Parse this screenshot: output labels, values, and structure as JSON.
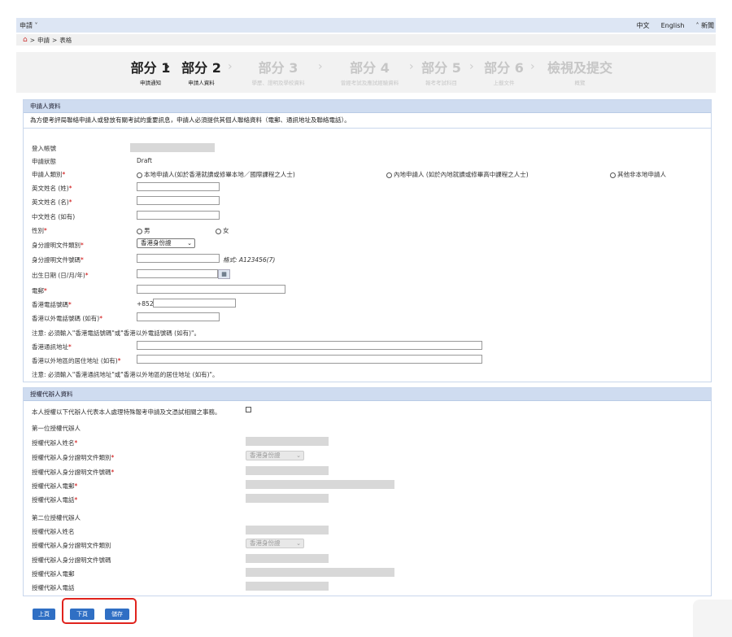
{
  "topbar": {
    "menu": "申請 ˅",
    "lang_zh": "中文",
    "lang_en": "English",
    "help": "˄ 新聞"
  },
  "breadcrumb": {
    "sep1": ">",
    "item1": "申請",
    "sep2": ">",
    "item2": "表格"
  },
  "steps": [
    {
      "title": "部分 1",
      "sub": "申請通知"
    },
    {
      "title": "部分 2",
      "sub": "申請人資料"
    },
    {
      "title": "部分 3",
      "sub": "學歷、證明及學校資料"
    },
    {
      "title": "部分 4",
      "sub": "曾經考試及應試經驗資料"
    },
    {
      "title": "部分 5",
      "sub": "報考考試科目"
    },
    {
      "title": "部分 6",
      "sub": "上載文件"
    },
    {
      "title": "檢視及提交",
      "sub": "概覽"
    }
  ],
  "applicant": {
    "header": "申請人資料",
    "notice": "為方便考評局聯絡申請人或發放有關考試的重要訊息，申請人必須提供其個人聯絡資料（電郵、通訊地址及聯絡電話）。",
    "login_no_label": "登入帳號",
    "status_label": "申請狀態",
    "status_value": "Draft",
    "category_label": "申請人類別",
    "category_options": [
      "本地申請人(如於香港就讀或修畢本地／國際課程之人士)",
      "內地申請人 (如於內地就讀或修畢高中課程之人士)",
      "其他非本地申請人"
    ],
    "surname_label": "英文姓名 (姓)",
    "given_label": "英文姓名 (名)",
    "chinese_label": "中文姓名 (如有)",
    "gender_label": "性別",
    "gender_male": "男",
    "gender_female": "女",
    "id_type_label": "身分證明文件類別",
    "id_type_value": "香港身份證",
    "id_no_label": "身分證明文件號碼",
    "id_format": "格式: A123456(7)",
    "dob_label": "出生日期 (日/月/年)",
    "email_label": "電郵",
    "hk_phone_label": "香港電話號碼",
    "hk_phone_prefix": "+852",
    "other_phone_label": "香港以外電話號碼 (如有)",
    "note_phone": "注意: 必須輸入\"香港電話號碼\"或\"香港以外電話號碼 (如有)\"。",
    "hk_addr_label": "香港通訊地址",
    "other_addr_label": "香港以外地區的居住地址 (如有)",
    "note_addr": "注意: 必須輸入\"香港通訊地址\"或\"香港以外地區的居住地址 (如有)\"。"
  },
  "agent": {
    "header": "授權代辦人資料",
    "authorize_text": "本人授權以下代辦人代表本人處理特殊報考申請及文憑試相關之事務。",
    "first_title": "第一位授權代辦人",
    "second_title": "第二位授權代辦人",
    "name_label": "授權代辦人姓名",
    "id_type_label": "授權代辦人身分證明文件類別",
    "id_type_value": "香港身份證",
    "id_no_label": "授權代辦人身分證明文件號碼",
    "email_label": "授權代辦人電郵",
    "phone_label": "授權代辦人電話"
  },
  "buttons": {
    "prev": "上頁",
    "next": "下頁",
    "save": "儲存"
  },
  "colors": {
    "accent": "#2f6fc4",
    "header_bg": "#cfdcf0",
    "highlight": "#e0231d"
  }
}
